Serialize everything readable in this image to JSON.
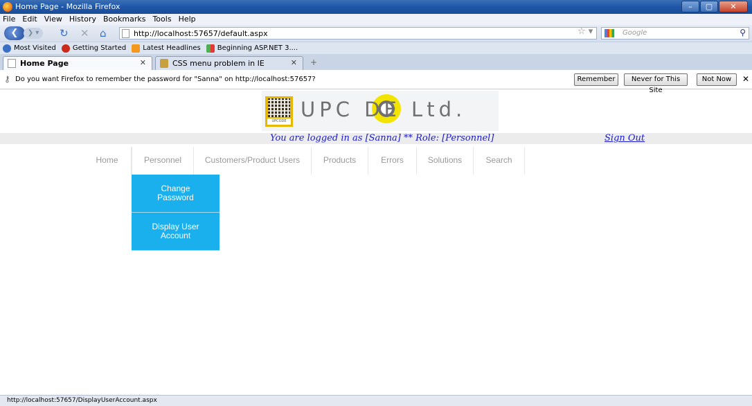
{
  "window": {
    "title": "Home Page - Mozilla Firefox",
    "buttons": [
      "–",
      "▢",
      "✕"
    ]
  },
  "menubar": [
    "File",
    "Edit",
    "View",
    "History",
    "Bookmarks",
    "Tools",
    "Help"
  ],
  "navbar": {
    "url": "http://localhost:57657/default.aspx",
    "search_placeholder": "Google",
    "icons": [
      "back-icon",
      "forward-icon",
      "reload-icon",
      "stop-icon",
      "home-icon",
      "star-icon",
      "search-icon"
    ]
  },
  "bookmarks": [
    {
      "label": "Most Visited",
      "color": "#3a6fc4"
    },
    {
      "label": "Getting Started",
      "color": "#cc2a1a"
    },
    {
      "label": "Latest Headlines",
      "color": "#f39a1e"
    },
    {
      "label": "Beginning ASP.NET 3....",
      "color": "#4caf50"
    }
  ],
  "tabs": [
    {
      "label": "Home Page",
      "active": true
    },
    {
      "label": "CSS menu problem in IE",
      "active": false
    }
  ],
  "notification": {
    "message": "Do you want Firefox to remember the password for \"Sanna\" on http://localhost:57657?",
    "remember": "Remember",
    "never": "Never for This Site",
    "not_now": "Not Now"
  },
  "logo": {
    "text": "UPC DE Ltd.",
    "mini": "UPCODE"
  },
  "userbar": {
    "status": "You are logged in as [Sanna] ** Role: [Personnel]",
    "signout": "Sign Out"
  },
  "mainnav": [
    "Home",
    "Personnel",
    "Customers/Product Users",
    "Products",
    "Errors",
    "Solutions",
    "Search"
  ],
  "dropdown": [
    "Change Password",
    "Display User Account"
  ],
  "status_bar": "http://localhost:57657/DisplayUserAccount.aspx",
  "colors": {
    "dropdown_bg": "#1ab0ee",
    "link": "#1a1acc",
    "titlebar": "#1f57a8"
  }
}
